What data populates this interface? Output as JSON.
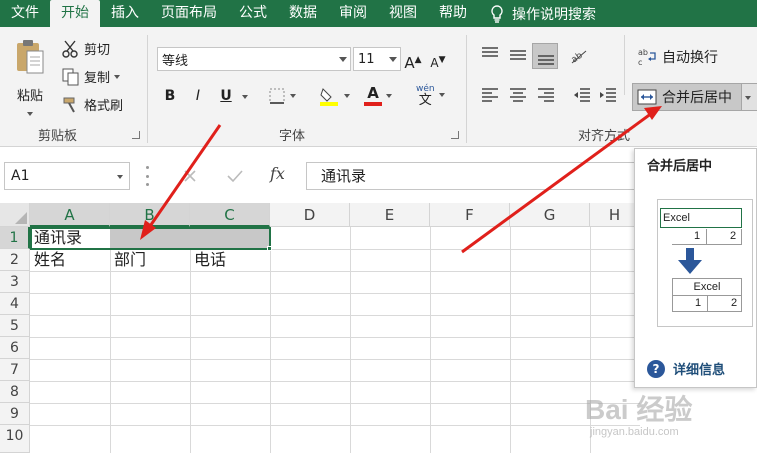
{
  "tabs": [
    "文件",
    "开始",
    "插入",
    "页面布局",
    "公式",
    "数据",
    "审阅",
    "视图",
    "帮助"
  ],
  "active_tab": "开始",
  "search_label": "操作说明搜索",
  "clipboard": {
    "paste": "粘贴",
    "cut": "剪切",
    "copy": "复制",
    "format_painter": "格式刷",
    "group_label": "剪贴板"
  },
  "font": {
    "name": "等线",
    "size": "11",
    "grow": "A",
    "shrink": "A",
    "bold": "B",
    "italic": "I",
    "underline": "U",
    "font_color_letter": "A",
    "phonetic_top": "wén",
    "phonetic_bottom": "文",
    "group_label": "字体"
  },
  "alignment": {
    "wrap_text": "自动换行",
    "merge_center": "合并后居中",
    "group_label": "对齐方式"
  },
  "formula_bar": {
    "name_box": "A1",
    "fx": "fx",
    "content": "通讯录"
  },
  "columns": [
    "A",
    "B",
    "C",
    "D",
    "E",
    "F",
    "G",
    "H"
  ],
  "rows": [
    "1",
    "2",
    "3",
    "4",
    "5",
    "6",
    "7",
    "8",
    "9",
    "10"
  ],
  "cells": {
    "A1": "通讯录",
    "A2": "姓名",
    "B2": "部门",
    "C2": "电话"
  },
  "tooltip": {
    "title": "合并后居中",
    "illus_before": "Excel",
    "illus_after": "Excel",
    "num1": "1",
    "num2": "2",
    "more_info": "详细信息"
  },
  "watermark": {
    "brand": "Bai 经验",
    "url": "jingyan.baidu.com"
  },
  "colors": {
    "excel_green": "#217346",
    "arrow_red": "#e0201b",
    "selection_gray": "#c8c8c8"
  }
}
